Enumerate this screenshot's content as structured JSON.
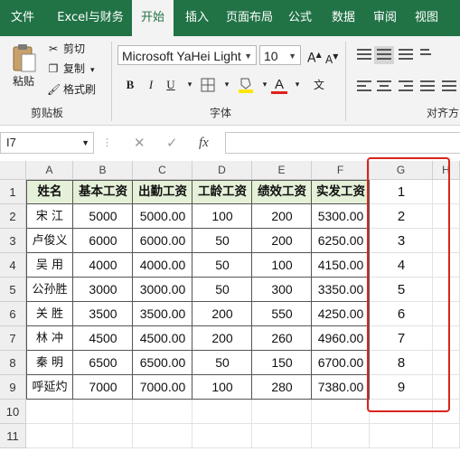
{
  "ribbon_tabs": [
    "文件",
    "Excel与财务",
    "开始",
    "插入",
    "页面布局",
    "公式",
    "数据",
    "审阅",
    "视图"
  ],
  "active_tab": "开始",
  "clipboard": {
    "paste_label": "粘贴",
    "cut_label": "剪切",
    "copy_label": "复制",
    "format_painter_label": "格式刷",
    "group_label": "剪贴板"
  },
  "font": {
    "font_name": "Microsoft YaHei Light",
    "font_size": "10",
    "bold": "B",
    "italic": "I",
    "underline": "U",
    "font_color_glyph": "A",
    "phonetic_glyph": "文",
    "group_label": "字体"
  },
  "alignment": {
    "group_label": "对齐方"
  },
  "formula_bar": {
    "name_box": "I7",
    "cancel_glyph": "✕",
    "enter_glyph": "✓",
    "fx_label": "fx",
    "formula": ""
  },
  "columns": [
    "A",
    "B",
    "C",
    "D",
    "E",
    "F",
    "G",
    "H"
  ],
  "rows": [
    "1",
    "2",
    "3",
    "4",
    "5",
    "6",
    "7",
    "8",
    "9",
    "10",
    "11"
  ],
  "table": {
    "headers": [
      "姓名",
      "基本工资",
      "出勤工资",
      "工龄工资",
      "绩效工资",
      "实发工资"
    ],
    "rows": [
      [
        "宋 江",
        "5000",
        "5000.00",
        "100",
        "200",
        "5300.00"
      ],
      [
        "卢俊义",
        "6000",
        "6000.00",
        "50",
        "200",
        "6250.00"
      ],
      [
        "吴 用",
        "4000",
        "4000.00",
        "50",
        "100",
        "4150.00"
      ],
      [
        "公孙胜",
        "3000",
        "3000.00",
        "50",
        "300",
        "3350.00"
      ],
      [
        "关 胜",
        "3500",
        "3500.00",
        "200",
        "550",
        "4250.00"
      ],
      [
        "林 冲",
        "4500",
        "4500.00",
        "200",
        "260",
        "4960.00"
      ],
      [
        "秦 明",
        "6500",
        "6500.00",
        "50",
        "150",
        "6700.00"
      ],
      [
        "呼延灼",
        "7000",
        "7000.00",
        "100",
        "280",
        "7380.00"
      ]
    ]
  },
  "column_g_values": [
    "1",
    "2",
    "3",
    "4",
    "5",
    "6",
    "7",
    "8",
    "9"
  ],
  "colors": {
    "excel_green": "#217346",
    "header_fill": "#e4f0d8",
    "highlight_red": "#d9251c",
    "font_red": "#e0201b",
    "highlight_yellow": "#ffe600"
  }
}
